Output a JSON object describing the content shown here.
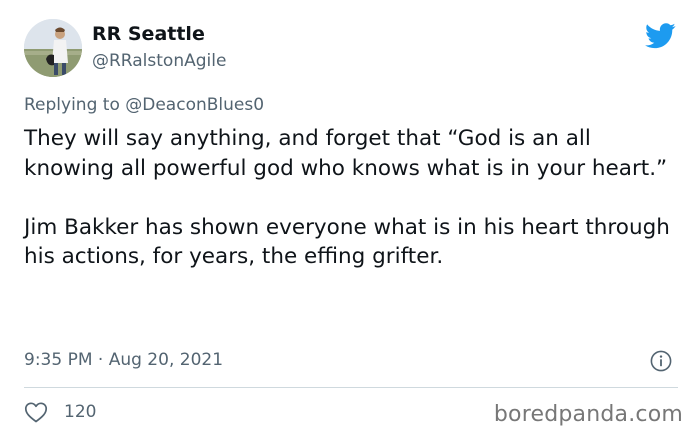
{
  "author": {
    "display_name": "RR Seattle",
    "handle": "@RRalstonAgile",
    "avatar_icon": "profile-photo"
  },
  "brand": {
    "icon": "twitter-bird-icon",
    "color": "#1d9bf0"
  },
  "reply": {
    "prefix": "Replying to",
    "mention": "@DeaconBlues0"
  },
  "tweet": {
    "paragraphs": [
      "They will say anything, and forget that “God is an all knowing all powerful god who knows what is in your heart.”",
      "Jim Bakker has shown everyone what is in his heart through his actions, for years, the effing grifter."
    ],
    "timestamp": "9:35 PM · Aug 20, 2021"
  },
  "actions": {
    "like_count": "120",
    "like_icon": "heart-icon",
    "info_icon": "info-icon"
  },
  "watermark": "boredpanda.com",
  "colors": {
    "text": "#0f1419",
    "secondary": "#536471",
    "divider": "#cfd9de"
  }
}
